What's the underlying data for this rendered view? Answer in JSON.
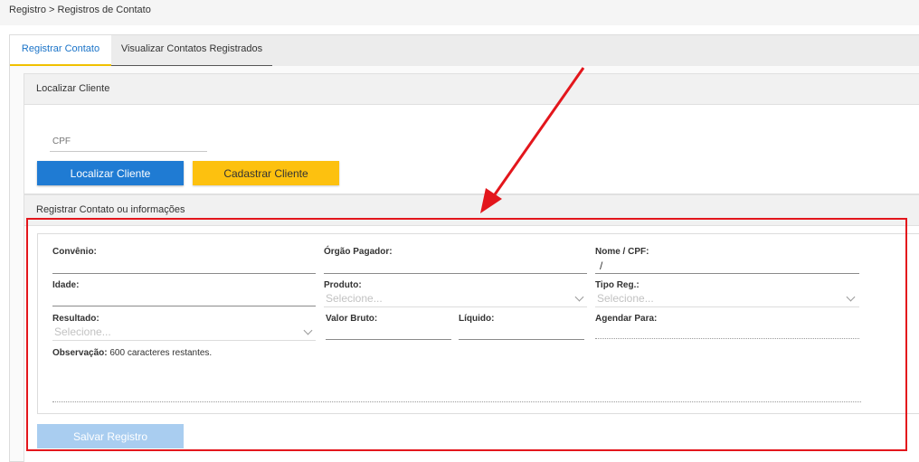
{
  "breadcrumb": "Registro > Registros de Contato",
  "tabs": [
    {
      "label": "Registrar Contato"
    },
    {
      "label": "Visualizar Contatos Registrados"
    }
  ],
  "localizar": {
    "title": "Localizar Cliente",
    "cpf_placeholder": "CPF",
    "cpf_value": "",
    "btn_localizar": "Localizar Cliente",
    "btn_cadastrar": "Cadastrar Cliente"
  },
  "registrar": {
    "title": "Registrar Contato ou informações",
    "convenio_label": "Convênio:",
    "orgao_label": "Órgão Pagador:",
    "nome_label": "Nome / CPF:",
    "nome_value": "/",
    "idade_label": "Idade:",
    "produto_label": "Produto:",
    "produto_value": "Selecione...",
    "tipo_label": "Tipo Reg.:",
    "tipo_value": "Selecione...",
    "resultado_label": "Resultado:",
    "resultado_value": "Selecione...",
    "valor_bruto_label": "Valor Bruto:",
    "liquido_label": "Líquido:",
    "agendar_label": "Agendar Para:",
    "obs_label": "Observação:",
    "obs_remaining": "600 caracteres restantes.",
    "save_label": "Salvar Registro"
  },
  "colors": {
    "accent_blue": "#1f7bd3",
    "accent_yellow": "#fdc10f",
    "annotation_red": "#e3161c",
    "disabled_blue": "#a9cdf0"
  }
}
